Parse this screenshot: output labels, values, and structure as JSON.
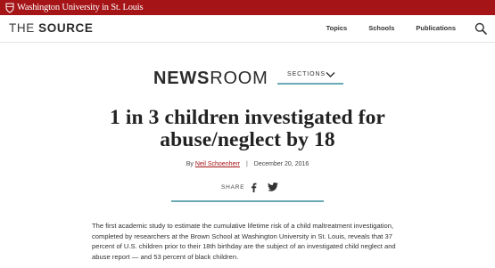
{
  "topbar": {
    "brand": "Washington University in St. Louis",
    "background": "#a51417"
  },
  "header": {
    "logo_prefix": "THE ",
    "logo_bold": "SOURCE",
    "nav": [
      "Topics",
      "Schools",
      "Publications"
    ],
    "search_icon": "search-icon"
  },
  "section": {
    "newsroom_bold": "NEWS",
    "newsroom_light": "ROOM",
    "sections_label": "SECTIONS",
    "accent": "#6aa9b5"
  },
  "article": {
    "headline": "1 in 3 children investigated for abuse/neglect by 18",
    "by": "By",
    "author": "Neil Schoenherr",
    "separator": "|",
    "date": "December 20, 2016",
    "share_label": "SHARE",
    "body": "The first academic study to estimate the cumulative lifetime risk of a child maltreatment investigation, completed by researchers at the Brown School at Washington University in St. Louis, reveals that 37 percent of U.S. children prior to their 18th birthday are the subject of an investigated child neglect and abuse report — and 53 percent of black children."
  }
}
